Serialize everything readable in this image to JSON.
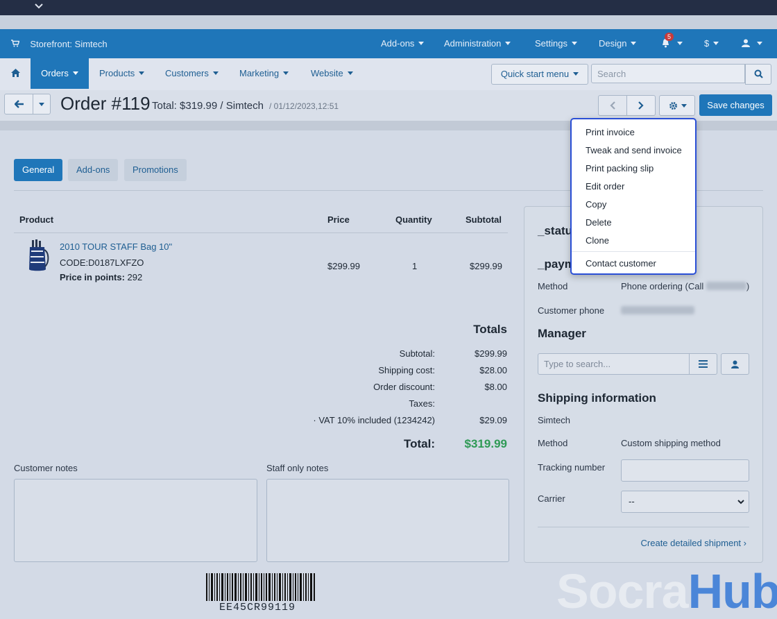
{
  "top_bar": {
    "storefront": "Storefront: Simtech",
    "menus": [
      "Add-ons",
      "Administration",
      "Settings",
      "Design"
    ],
    "notification_count": "5",
    "currency": "$"
  },
  "nav": {
    "items": [
      "Orders",
      "Products",
      "Customers",
      "Marketing",
      "Website"
    ],
    "quick_start": "Quick start menu",
    "search_placeholder": "Search"
  },
  "header": {
    "title": "Order #119",
    "subtitle": "Total: $319.99 / Simtech",
    "date": "/ 01/12/2023,12:51",
    "save_label": "Save changes"
  },
  "tabs": [
    "General",
    "Add-ons",
    "Promotions"
  ],
  "products_table": {
    "headers": [
      "Product",
      "Price",
      "Quantity",
      "Subtotal"
    ],
    "rows": [
      {
        "name": "2010 TOUR STAFF Bag 10\"",
        "code": "CODE:D0187LXFZO",
        "points_label": "Price in points:",
        "points": "292",
        "price": "$299.99",
        "quantity": "1",
        "subtotal": "$299.99"
      }
    ]
  },
  "totals": {
    "heading": "Totals",
    "lines": [
      {
        "label": "Subtotal:",
        "value": "$299.99"
      },
      {
        "label": "Shipping cost:",
        "value": "$28.00"
      },
      {
        "label": "Order discount:",
        "value": "$8.00"
      },
      {
        "label": "Taxes:",
        "value": ""
      },
      {
        "label": "· VAT 10% included (1234242)",
        "value": "$29.09"
      }
    ],
    "total_label": "Total:",
    "total_value": "$319.99"
  },
  "notes": {
    "customer": "Customer notes",
    "staff": "Staff only notes"
  },
  "barcode_text": "EE45CR99119",
  "side_panel": {
    "status_heading": "_statu",
    "payment_heading": "_paym",
    "method_label": "Method",
    "method_value": "Phone ordering (Call",
    "method_value_end": ")",
    "phone_label": "Customer phone",
    "manager_heading": "Manager",
    "manager_placeholder": "Type to search...",
    "shipping_heading": "Shipping information",
    "shipping_vendor": "Simtech",
    "ship_method_label": "Method",
    "ship_method_value": "Custom shipping method",
    "tracking_label": "Tracking number",
    "carrier_label": "Carrier",
    "carrier_value": "--",
    "shipment_link": "Create detailed shipment ›"
  },
  "dropdown_menu": [
    "Print invoice",
    "Tweak and send invoice",
    "Print packing slip",
    "Edit order",
    "Copy",
    "Delete",
    "Clone",
    "Contact customer"
  ],
  "watermark": {
    "part1": "Socra",
    "part2": "Hub"
  },
  "colors": {
    "primary": "#1f76b9",
    "nav_dark": "#242e45",
    "total_green": "#2e9a55",
    "dropdown_border": "#2a4fd6"
  }
}
